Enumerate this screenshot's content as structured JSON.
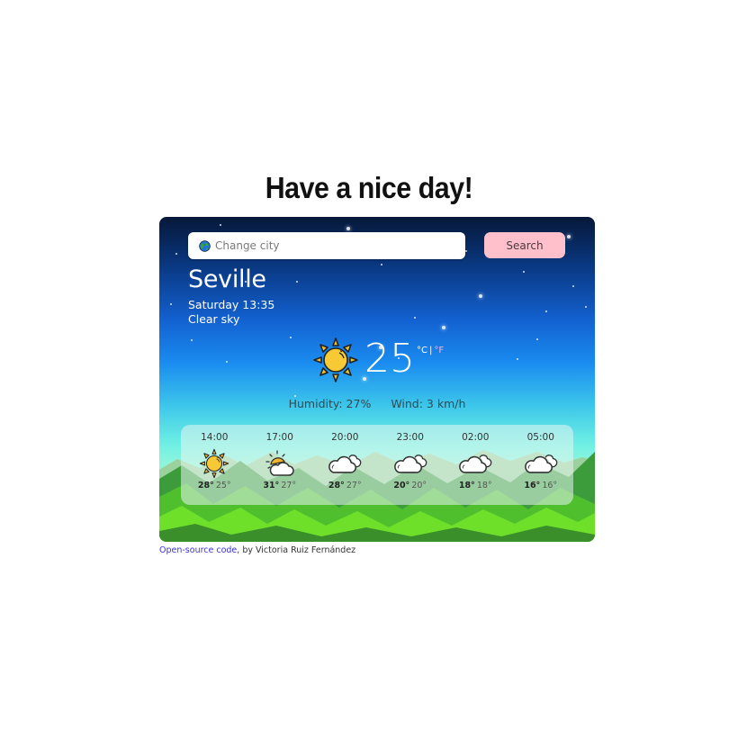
{
  "page": {
    "title": "Have a nice day!"
  },
  "search": {
    "placeholder": "Change city",
    "value": "",
    "button_label": "Search",
    "icon": "globe-icon"
  },
  "current": {
    "city": "Seville",
    "datetime": "Saturday 13:35",
    "condition": "Clear sky",
    "icon": "sun-icon",
    "temperature": "25",
    "unit_celsius": "°C",
    "unit_separator": "|",
    "unit_fahrenheit": "°F",
    "humidity": "Humidity: 27%",
    "wind": "Wind: 3 km/h"
  },
  "forecast": [
    {
      "time": "14:00",
      "icon": "sun-icon",
      "max": "28°",
      "min": "25°"
    },
    {
      "time": "17:00",
      "icon": "partly-cloudy-icon",
      "max": "31°",
      "min": "27°"
    },
    {
      "time": "20:00",
      "icon": "clouds-icon",
      "max": "28°",
      "min": "27°"
    },
    {
      "time": "23:00",
      "icon": "clouds-icon",
      "max": "20°",
      "min": "20°"
    },
    {
      "time": "02:00",
      "icon": "clouds-icon",
      "max": "18°",
      "min": "18°"
    },
    {
      "time": "05:00",
      "icon": "clouds-icon",
      "max": "16°",
      "min": "16°"
    }
  ],
  "footer": {
    "link_text": "Open-source code",
    "suffix": ", by Victoria Ruiz Fernández"
  },
  "colors": {
    "search_button": "#ffc0cb",
    "link": "#3a32e0",
    "fahrenheit": "#ffb3d9"
  }
}
